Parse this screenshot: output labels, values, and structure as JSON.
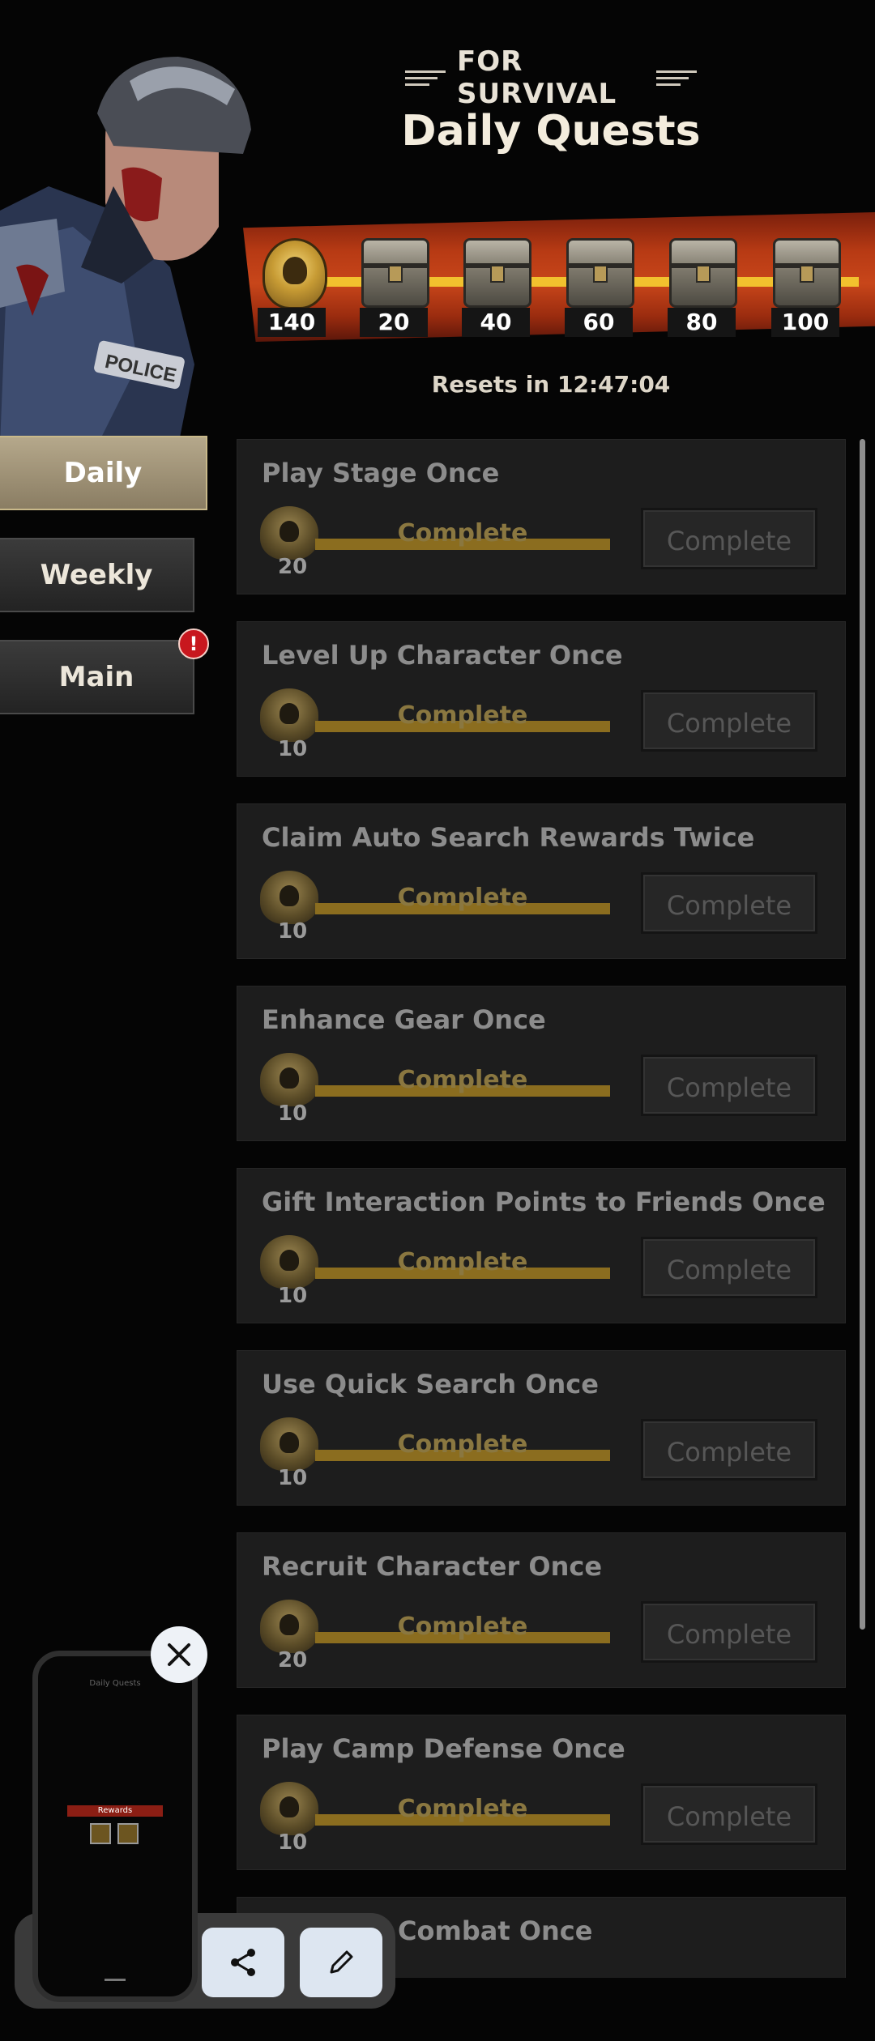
{
  "header": {
    "subtitle": "FOR SURVIVAL",
    "title": "Daily Quests",
    "resets_text": "Resets in 12:47:04"
  },
  "milestones": [
    {
      "value": "140",
      "icon": "medal-icon"
    },
    {
      "value": "20",
      "icon": "chest-icon"
    },
    {
      "value": "40",
      "icon": "chest-icon"
    },
    {
      "value": "60",
      "icon": "chest-icon"
    },
    {
      "value": "80",
      "icon": "chest-icon"
    },
    {
      "value": "100",
      "icon": "chest-icon"
    }
  ],
  "tabs": [
    {
      "label": "Daily",
      "active": true
    },
    {
      "label": "Weekly",
      "active": false
    },
    {
      "label": "Main",
      "active": false,
      "badge": "!"
    }
  ],
  "quests": [
    {
      "name": "Play Stage Once",
      "reward": "20",
      "progress_text": "Complete",
      "progress": 1.0,
      "button": "Complete"
    },
    {
      "name": "Level Up Character Once",
      "reward": "10",
      "progress_text": "Complete",
      "progress": 1.0,
      "button": "Complete"
    },
    {
      "name": "Claim Auto Search Rewards Twice",
      "reward": "10",
      "progress_text": "Complete",
      "progress": 1.0,
      "button": "Complete"
    },
    {
      "name": "Enhance Gear Once",
      "reward": "10",
      "progress_text": "Complete",
      "progress": 1.0,
      "button": "Complete"
    },
    {
      "name": "Gift Interaction Points to Friends Once",
      "reward": "10",
      "progress_text": "Complete",
      "progress": 1.0,
      "button": "Complete"
    },
    {
      "name": "Use Quick Search Once",
      "reward": "10",
      "progress_text": "Complete",
      "progress": 1.0,
      "button": "Complete"
    },
    {
      "name": "Recruit Character Once",
      "reward": "20",
      "progress_text": "Complete",
      "progress": 1.0,
      "button": "Complete"
    },
    {
      "name": "Play Camp Defense Once",
      "reward": "10",
      "progress_text": "Complete",
      "progress": 1.0,
      "button": "Complete"
    },
    {
      "name": "Combat Once",
      "reward": "",
      "progress_text": "",
      "progress": 1.0,
      "button": ""
    }
  ],
  "preview": {
    "banner_text": "Rewards"
  },
  "colors": {
    "banner_red": "#b73a14",
    "track_yellow": "#f2c12e",
    "badge_red": "#c8171e",
    "active_tab": "#b5a88b"
  }
}
